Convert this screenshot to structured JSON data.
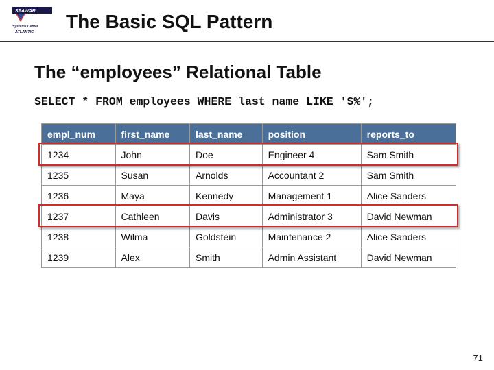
{
  "logo": {
    "label_top": "SPAWAR",
    "label_mid": "Systems Center",
    "label_bot": "ATLANTIC"
  },
  "title": "The Basic SQL Pattern",
  "subtitle": "The “employees” Relational Table",
  "sql": "SELECT * FROM employees WHERE last_name LIKE 'S%';",
  "table": {
    "headers": [
      "empl_num",
      "first_name",
      "last_name",
      "position",
      "reports_to"
    ],
    "rows": [
      [
        "1234",
        "John",
        "Doe",
        "Engineer 4",
        "Sam Smith"
      ],
      [
        "1235",
        "Susan",
        "Arnolds",
        "Accountant 2",
        "Sam Smith"
      ],
      [
        "1236",
        "Maya",
        "Kennedy",
        "Management 1",
        "Alice Sanders"
      ],
      [
        "1237",
        "Cathleen",
        "Davis",
        "Administrator 3",
        "David Newman"
      ],
      [
        "1238",
        "Wilma",
        "Goldstein",
        "Maintenance 2",
        "Alice Sanders"
      ],
      [
        "1239",
        "Alex",
        "Smith",
        "Admin Assistant",
        "David Newman"
      ]
    ]
  },
  "highlight_rows": [
    0,
    3
  ],
  "page_number": "71"
}
